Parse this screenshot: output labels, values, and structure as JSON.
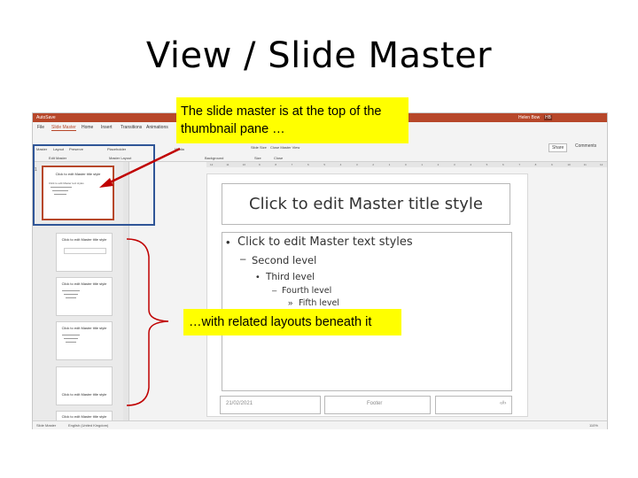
{
  "slide": {
    "title": "View / Slide Master"
  },
  "app": {
    "titlebar": {
      "autosave": "AutoSave",
      "user": "Helen Bow",
      "user_initials": "HB"
    },
    "menu": [
      "File",
      "Slide Master",
      "Home",
      "Insert",
      "Transitions",
      "Animations"
    ],
    "ribbon": {
      "insert_slide_master": "Insert Slide Master",
      "insert_layout": "Insert Layout",
      "preserve": "Preserve",
      "layout": "Layout",
      "placeholder": "Placeholder",
      "master": "Master",
      "edit_master": "Edit Master",
      "master_layout": "Master Layout",
      "media": "Media",
      "background": "Background",
      "slide_size": "Slide Size",
      "close_master_view": "Close Master View",
      "size": "Size",
      "close": "Close",
      "share": "Share",
      "comments": "Comments"
    },
    "status": {
      "view": "Slide Master",
      "language": "English (United Kingdom)",
      "zoom": "110%"
    },
    "thumbnails": [
      {
        "title": "Click to edit Master title style",
        "text": "Click to edit Master text styles",
        "number": "1"
      },
      {
        "title": "Click to edit Master title style",
        "text": ""
      },
      {
        "title": "Click to edit Master title style",
        "text": ""
      },
      {
        "title": "Click to edit Master title style",
        "text": ""
      },
      {
        "title": "Click to edit Master title style",
        "text": ""
      },
      {
        "title": "Click to edit Master title style",
        "text": ""
      }
    ],
    "ruler_numbers": [
      "12",
      "11",
      "10",
      "9",
      "8",
      "7",
      "6",
      "5",
      "4",
      "3",
      "2",
      "1",
      "0",
      "1",
      "2",
      "3",
      "4",
      "5",
      "6",
      "7",
      "8",
      "9",
      "10",
      "11",
      "12"
    ]
  },
  "master_slide": {
    "title": "Click to edit Master title style",
    "levels": [
      {
        "bullet": "•",
        "text": "Click to edit Master text styles"
      },
      {
        "bullet": "–",
        "text": "Second level"
      },
      {
        "bullet": "•",
        "text": "Third level"
      },
      {
        "bullet": "–",
        "text": "Fourth level"
      },
      {
        "bullet": "»",
        "text": "Fifth level"
      }
    ],
    "date": "21/02/2021",
    "footer": "Footer",
    "slide_number": "‹#›"
  },
  "callouts": {
    "top": "The slide master is at the top of the thumbnail pane …",
    "bottom": "…with related layouts beneath it"
  }
}
